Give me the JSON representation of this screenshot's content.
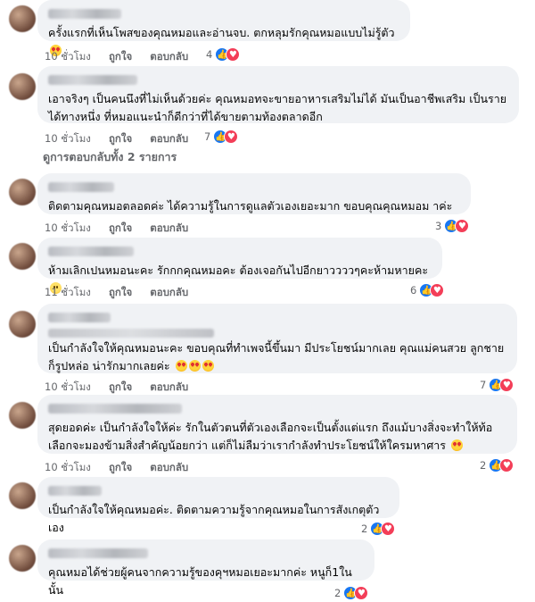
{
  "comments": [
    {
      "text": "ครั้งแรกที่เห็นโพสของคุณหมอและอ่านจบ. ตกหลุมรักคุณหมอแบบไม่รู้ตัว",
      "emoji": "heart-eyes",
      "time": "10 ชั่วโมง",
      "like": "ถูกใจ",
      "reply": "ตอบกลับ",
      "count": "4"
    },
    {
      "text": "เอาจริงๆ เป็นคนนึงที่ไม่เห็นด้วยค่ะ คุณหมอทจะขายอาหารเสริมไม่ได้ มันเป็นอาชีพเสริม เป็นรายได้ทางหนึ่ง ที่หมอแนะนำก็ดีกว่าที่ได้ขายตามท้องตลาดอีก",
      "emoji": "",
      "time": "10 ชั่วโมง",
      "like": "ถูกใจ",
      "reply": "ตอบกลับ",
      "count": "7"
    },
    {
      "text": "ติดตามคุณหมอตลอดค่ะ ได้ความรู้ในการดูแลตัวเองเยอะมาก ขอบคุณคุณหมอม าค่ะ",
      "emoji": "",
      "time": "10 ชั่วโมง",
      "like": "ถูกใจ",
      "reply": "ตอบกลับ",
      "count": "3"
    },
    {
      "text": "ห้ามเลิกเปนหมอนะคะ รักกกคุณหมอคะ ต้องเจอกันไปอีกยาววววๆคะห้ามหายคะ",
      "emoji": "grin",
      "time": "11 ชั่วโมง",
      "like": "ถูกใจ",
      "reply": "ตอบกลับ",
      "count": "6"
    },
    {
      "text": "เป็นกำลังใจให้คุณหมอนะคะ ขอบคุณที่ทำเพจนี้ขึ้นมา มีประโยชน์มากเลย คุณแม่คนสวย ลูกชายก็รูปหล่อ น่ารักมากเลยค่ะ",
      "emoji": "heart-eyes-x3",
      "time": "10 ชั่วโมง",
      "like": "ถูกใจ",
      "reply": "ตอบกลับ",
      "count": "7"
    },
    {
      "text": "สุดยอดค่ะ เป็นกำลังใจให้ค่ะ รักในตัวตนที่ตัวเองเลือกจะเป็นตั้งแต่แรก ถึงแม้บางสิ่งจะทำให้ท้อ เลือกจะมองข้ามสิ่งสำคัญน้อยกว่า แต่ก็ไม่ลืมว่าเรากำลังทำประโยชน์ให้ใครมหาศาร",
      "emoji": "heart-eyes",
      "time": "10 ชั่วโมง",
      "like": "ถูกใจ",
      "reply": "ตอบกลับ",
      "count": "2"
    },
    {
      "text": "เป็นกำลังใจให้คุณหมอค่ะ. ติดตามความรู้จากคุณหมอในการสังเกตุตัวเอง",
      "emoji": "",
      "time": "10 ชั่วโมง",
      "like": "ถูกใจ",
      "reply": "ตอบกลับ",
      "count": "2"
    },
    {
      "text": "คุณหมอได้ช่วยผู้คนจากความรู้ของคุฯหมอเยอะมากค่ะ หนูก็1ในนั้น",
      "emoji": "",
      "time": "10 ชั่วโมง",
      "like": "ถูกใจ",
      "reply": "ตอบกลับ",
      "count": "2"
    }
  ],
  "view_replies": "ดูการตอบกลับทั้ง 2 รายการ"
}
